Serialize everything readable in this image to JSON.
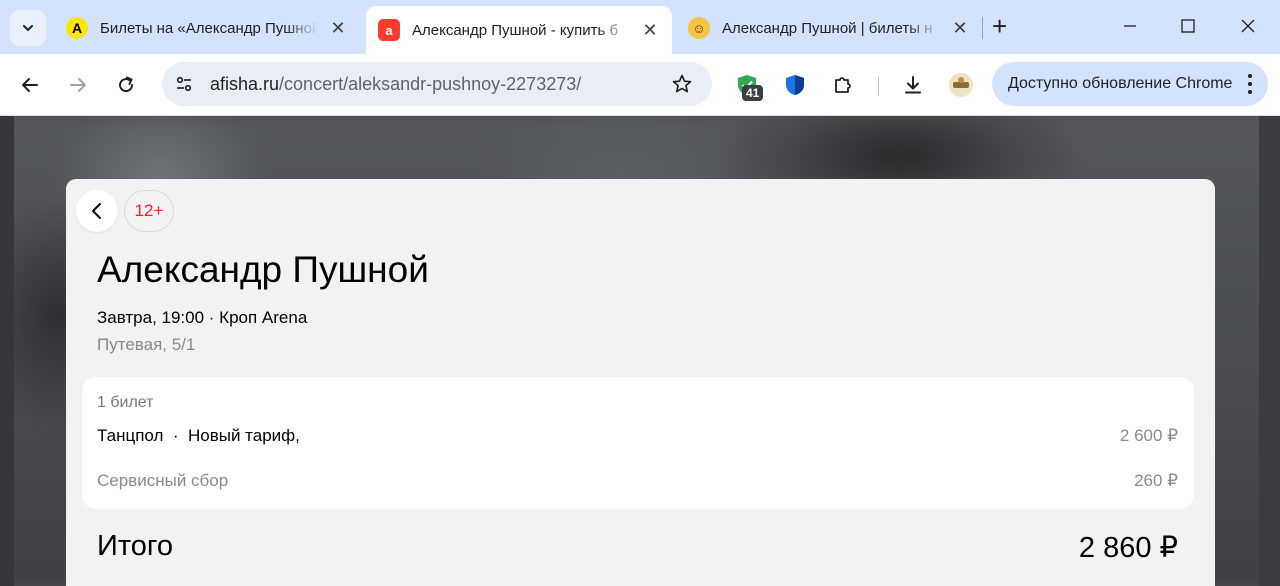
{
  "browser": {
    "tabs": [
      {
        "title": "Билеты на «Александр Пушной",
        "favicon": "afisha-a-icon",
        "favicon_color": "#ffe600"
      },
      {
        "title": "Александр Пушной - купить б",
        "favicon": "afisha-logo-icon",
        "favicon_color": "#ff3b30",
        "active": true
      },
      {
        "title": "Александр Пушной | билеты н",
        "favicon": "smiley-icon",
        "favicon_color": "#f6c343"
      }
    ],
    "url": {
      "host": "afisha.ru",
      "path": "/concert/aleksandr-pushnoy-2273273/"
    },
    "extension_badge": "41",
    "update_label": "Доступно обновление Chrome"
  },
  "event": {
    "age_rating": "12+",
    "title": "Александр Пушной",
    "when_venue": "Завтра, 19:00 · Кроп Arena",
    "address": "Путевая, 5/1"
  },
  "order": {
    "ticket_count": "1 билет",
    "ticket_line": "Танцпол  ·  Новый тариф,",
    "ticket_price": "2 600 ₽",
    "fee_label": "Сервисный сбор",
    "fee_price": "260 ₽",
    "total_label": "Итого",
    "total_price": "2 860 ₽"
  },
  "colors": {
    "accent_red": "#f5222d",
    "chrome_tabstrip": "#d3e3fd"
  }
}
